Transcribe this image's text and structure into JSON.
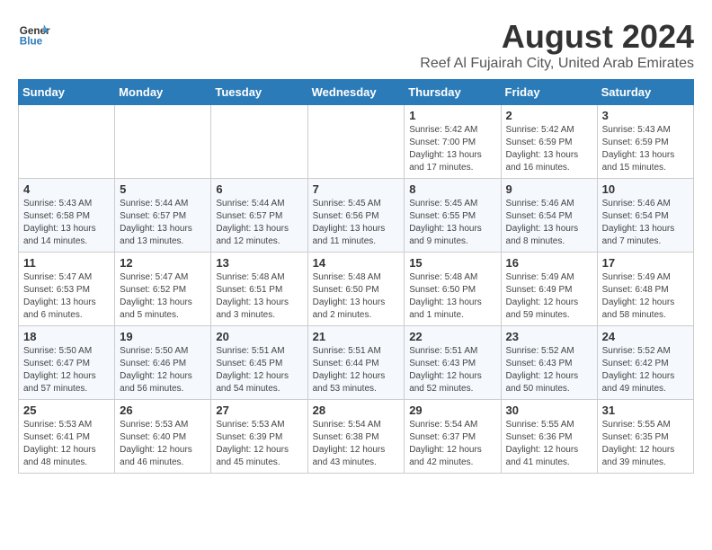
{
  "logo": {
    "text_general": "General",
    "text_blue": "Blue"
  },
  "header": {
    "month_year": "August 2024",
    "location": "Reef Al Fujairah City, United Arab Emirates"
  },
  "weekdays": [
    "Sunday",
    "Monday",
    "Tuesday",
    "Wednesday",
    "Thursday",
    "Friday",
    "Saturday"
  ],
  "weeks": [
    [
      {
        "day": "",
        "info": ""
      },
      {
        "day": "",
        "info": ""
      },
      {
        "day": "",
        "info": ""
      },
      {
        "day": "",
        "info": ""
      },
      {
        "day": "1",
        "info": "Sunrise: 5:42 AM\nSunset: 7:00 PM\nDaylight: 13 hours\nand 17 minutes."
      },
      {
        "day": "2",
        "info": "Sunrise: 5:42 AM\nSunset: 6:59 PM\nDaylight: 13 hours\nand 16 minutes."
      },
      {
        "day": "3",
        "info": "Sunrise: 5:43 AM\nSunset: 6:59 PM\nDaylight: 13 hours\nand 15 minutes."
      }
    ],
    [
      {
        "day": "4",
        "info": "Sunrise: 5:43 AM\nSunset: 6:58 PM\nDaylight: 13 hours\nand 14 minutes."
      },
      {
        "day": "5",
        "info": "Sunrise: 5:44 AM\nSunset: 6:57 PM\nDaylight: 13 hours\nand 13 minutes."
      },
      {
        "day": "6",
        "info": "Sunrise: 5:44 AM\nSunset: 6:57 PM\nDaylight: 13 hours\nand 12 minutes."
      },
      {
        "day": "7",
        "info": "Sunrise: 5:45 AM\nSunset: 6:56 PM\nDaylight: 13 hours\nand 11 minutes."
      },
      {
        "day": "8",
        "info": "Sunrise: 5:45 AM\nSunset: 6:55 PM\nDaylight: 13 hours\nand 9 minutes."
      },
      {
        "day": "9",
        "info": "Sunrise: 5:46 AM\nSunset: 6:54 PM\nDaylight: 13 hours\nand 8 minutes."
      },
      {
        "day": "10",
        "info": "Sunrise: 5:46 AM\nSunset: 6:54 PM\nDaylight: 13 hours\nand 7 minutes."
      }
    ],
    [
      {
        "day": "11",
        "info": "Sunrise: 5:47 AM\nSunset: 6:53 PM\nDaylight: 13 hours\nand 6 minutes."
      },
      {
        "day": "12",
        "info": "Sunrise: 5:47 AM\nSunset: 6:52 PM\nDaylight: 13 hours\nand 5 minutes."
      },
      {
        "day": "13",
        "info": "Sunrise: 5:48 AM\nSunset: 6:51 PM\nDaylight: 13 hours\nand 3 minutes."
      },
      {
        "day": "14",
        "info": "Sunrise: 5:48 AM\nSunset: 6:50 PM\nDaylight: 13 hours\nand 2 minutes."
      },
      {
        "day": "15",
        "info": "Sunrise: 5:48 AM\nSunset: 6:50 PM\nDaylight: 13 hours\nand 1 minute."
      },
      {
        "day": "16",
        "info": "Sunrise: 5:49 AM\nSunset: 6:49 PM\nDaylight: 12 hours\nand 59 minutes."
      },
      {
        "day": "17",
        "info": "Sunrise: 5:49 AM\nSunset: 6:48 PM\nDaylight: 12 hours\nand 58 minutes."
      }
    ],
    [
      {
        "day": "18",
        "info": "Sunrise: 5:50 AM\nSunset: 6:47 PM\nDaylight: 12 hours\nand 57 minutes."
      },
      {
        "day": "19",
        "info": "Sunrise: 5:50 AM\nSunset: 6:46 PM\nDaylight: 12 hours\nand 56 minutes."
      },
      {
        "day": "20",
        "info": "Sunrise: 5:51 AM\nSunset: 6:45 PM\nDaylight: 12 hours\nand 54 minutes."
      },
      {
        "day": "21",
        "info": "Sunrise: 5:51 AM\nSunset: 6:44 PM\nDaylight: 12 hours\nand 53 minutes."
      },
      {
        "day": "22",
        "info": "Sunrise: 5:51 AM\nSunset: 6:43 PM\nDaylight: 12 hours\nand 52 minutes."
      },
      {
        "day": "23",
        "info": "Sunrise: 5:52 AM\nSunset: 6:43 PM\nDaylight: 12 hours\nand 50 minutes."
      },
      {
        "day": "24",
        "info": "Sunrise: 5:52 AM\nSunset: 6:42 PM\nDaylight: 12 hours\nand 49 minutes."
      }
    ],
    [
      {
        "day": "25",
        "info": "Sunrise: 5:53 AM\nSunset: 6:41 PM\nDaylight: 12 hours\nand 48 minutes."
      },
      {
        "day": "26",
        "info": "Sunrise: 5:53 AM\nSunset: 6:40 PM\nDaylight: 12 hours\nand 46 minutes."
      },
      {
        "day": "27",
        "info": "Sunrise: 5:53 AM\nSunset: 6:39 PM\nDaylight: 12 hours\nand 45 minutes."
      },
      {
        "day": "28",
        "info": "Sunrise: 5:54 AM\nSunset: 6:38 PM\nDaylight: 12 hours\nand 43 minutes."
      },
      {
        "day": "29",
        "info": "Sunrise: 5:54 AM\nSunset: 6:37 PM\nDaylight: 12 hours\nand 42 minutes."
      },
      {
        "day": "30",
        "info": "Sunrise: 5:55 AM\nSunset: 6:36 PM\nDaylight: 12 hours\nand 41 minutes."
      },
      {
        "day": "31",
        "info": "Sunrise: 5:55 AM\nSunset: 6:35 PM\nDaylight: 12 hours\nand 39 minutes."
      }
    ]
  ]
}
